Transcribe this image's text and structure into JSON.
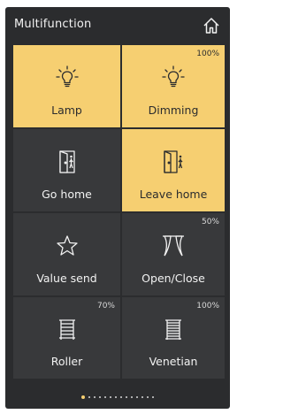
{
  "header": {
    "title": "Multifunction",
    "home_icon": "home-icon"
  },
  "colors": {
    "panel_bg": "#2b2c2e",
    "tile_off": "#38393b",
    "tile_on": "#f6cf71",
    "text_light": "#f2f2f2"
  },
  "tiles": [
    {
      "label": "Lamp",
      "state": "on",
      "icon": "bulb-icon",
      "value": ""
    },
    {
      "label": "Dimming",
      "state": "on",
      "icon": "bulb-icon",
      "value": "100%"
    },
    {
      "label": "Go home",
      "state": "off",
      "icon": "door-enter-icon",
      "value": ""
    },
    {
      "label": "Leave home",
      "state": "on",
      "icon": "door-exit-icon",
      "value": ""
    },
    {
      "label": "Value send",
      "state": "off",
      "icon": "star-icon",
      "value": ""
    },
    {
      "label": "Open/Close",
      "state": "off",
      "icon": "curtain-icon",
      "value": "50%"
    },
    {
      "label": "Roller",
      "state": "off",
      "icon": "roller-blind-icon",
      "value": "70%"
    },
    {
      "label": "Venetian",
      "state": "off",
      "icon": "venetian-blind-icon",
      "value": "100%"
    }
  ],
  "pager": {
    "total": 14,
    "active_index": 0
  }
}
